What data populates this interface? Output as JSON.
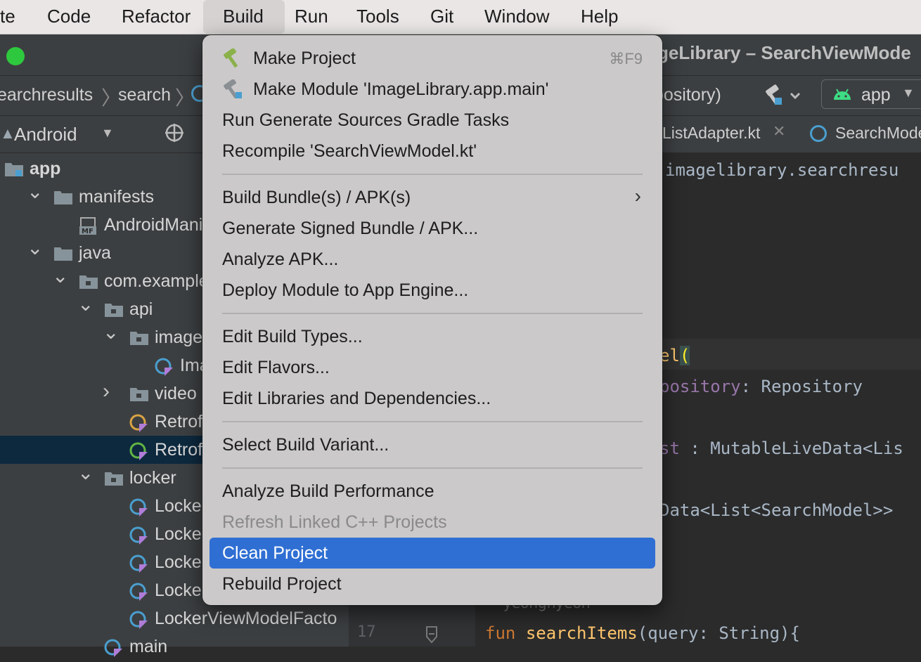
{
  "menubar": {
    "items": [
      "te",
      "Code",
      "Refactor",
      "Build",
      "Run",
      "Tools",
      "Git",
      "Window",
      "Help"
    ],
    "active": "Build"
  },
  "window": {
    "title": "geLibrary – SearchViewMode"
  },
  "breadcrumbs": {
    "items": [
      "earchresults",
      "search"
    ],
    "repository_fragment": "pository)"
  },
  "run_config": {
    "selected": "app"
  },
  "project_panel": {
    "view_mode": "Android",
    "tree": [
      {
        "label": "app",
        "level": 0,
        "bold": true
      },
      {
        "label": "manifests",
        "level": 1,
        "expanded": true
      },
      {
        "label": "AndroidManife",
        "level": 2
      },
      {
        "label": "java",
        "level": 1,
        "expanded": true
      },
      {
        "label": "com.example.i",
        "level": 2,
        "expanded": true
      },
      {
        "label": "api",
        "level": 3,
        "expanded": true
      },
      {
        "label": "image",
        "level": 4,
        "expanded": true
      },
      {
        "label": "Image",
        "level": 5
      },
      {
        "label": "video",
        "level": 4,
        "expanded": false
      },
      {
        "label": "RetrofitC",
        "level": 4
      },
      {
        "label": "RetrofitI",
        "level": 4,
        "selected": true
      },
      {
        "label": "locker",
        "level": 3,
        "expanded": true
      },
      {
        "label": "LockerFr",
        "level": 4
      },
      {
        "label": "LockerLi",
        "level": 4
      },
      {
        "label": "LockerM",
        "level": 4
      },
      {
        "label": "LockerVi",
        "level": 4
      },
      {
        "label": "LockerViewModelFacto",
        "level": 4
      },
      {
        "label": "main",
        "level": 3
      }
    ]
  },
  "editor": {
    "tabs": [
      "ListAdapter.kt",
      "SearchMode"
    ],
    "code_lines": {
      "package_fragment": "imagelibrary.searchresu",
      "class_fragment": "el",
      "paren": "(",
      "param_fragment": "pository",
      "param_type": ": Repository",
      "field_fragment": "st",
      "field_type": " : MutableLiveData<Lis",
      "livedata_fragment": "Data<List<SearchModel>>",
      "author_fragment": "yeongnyeon",
      "fun_keyword": "fun",
      "fun_name": "searchItems",
      "fun_params": "(query: String){",
      "line_number": "17"
    }
  },
  "build_menu": {
    "items": [
      {
        "type": "item",
        "label": "Make Project",
        "shortcut": "⌘F9",
        "icon": "hammer-icon"
      },
      {
        "type": "item",
        "label": "Make Module 'ImageLibrary.app.main'",
        "icon": "make-module-icon"
      },
      {
        "type": "item",
        "label": "Run Generate Sources Gradle Tasks"
      },
      {
        "type": "item",
        "label": "Recompile 'SearchViewModel.kt'"
      },
      {
        "type": "separator"
      },
      {
        "type": "item",
        "label": "Build Bundle(s) / APK(s)",
        "submenu": true
      },
      {
        "type": "item",
        "label": "Generate Signed Bundle / APK..."
      },
      {
        "type": "item",
        "label": "Analyze APK..."
      },
      {
        "type": "item",
        "label": "Deploy Module to App Engine..."
      },
      {
        "type": "separator"
      },
      {
        "type": "item",
        "label": "Edit Build Types..."
      },
      {
        "type": "item",
        "label": "Edit Flavors..."
      },
      {
        "type": "item",
        "label": "Edit Libraries and Dependencies..."
      },
      {
        "type": "separator"
      },
      {
        "type": "item",
        "label": "Select Build Variant..."
      },
      {
        "type": "separator"
      },
      {
        "type": "item",
        "label": "Analyze Build Performance"
      },
      {
        "type": "item",
        "label": "Refresh Linked C++ Projects",
        "disabled": true
      },
      {
        "type": "item",
        "label": "Clean Project",
        "highlighted": true
      },
      {
        "type": "item",
        "label": "Rebuild Project"
      }
    ]
  },
  "colors": {
    "menu_highlight": "#2f6fd3",
    "selection_row": "#0d293e",
    "keyword": "#cc7832",
    "function": "#ffc66d",
    "param": "#9876aa"
  }
}
